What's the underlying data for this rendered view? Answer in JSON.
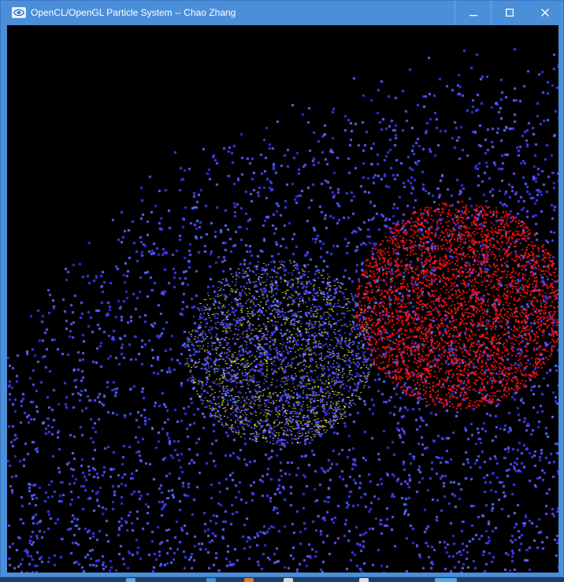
{
  "window": {
    "title": "OpenCL/OpenGL Particle System -- Chao Zhang",
    "app_icon": "opengl-app-icon",
    "caption_buttons": [
      {
        "name": "minimize",
        "icon": "minimize-icon"
      },
      {
        "name": "maximize",
        "icon": "maximize-icon"
      },
      {
        "name": "close",
        "icon": "close-icon"
      }
    ]
  },
  "colors": {
    "titlebar": "#4b8fd8",
    "background": "#000000",
    "particle_blue": "#3a3cf0",
    "particle_blue_light": "#4e70f6",
    "particle_violet": "#6a4af2",
    "sphere_red": "#ff1010",
    "sphere_yellow": "#f2f000",
    "taskbar": "#1c3d66"
  },
  "scene": {
    "particles": "particle-field",
    "spheres": [
      {
        "name": "yellow-sphere",
        "color": "#f2f000"
      },
      {
        "name": "red-sphere",
        "color": "#ff1010"
      }
    ]
  }
}
